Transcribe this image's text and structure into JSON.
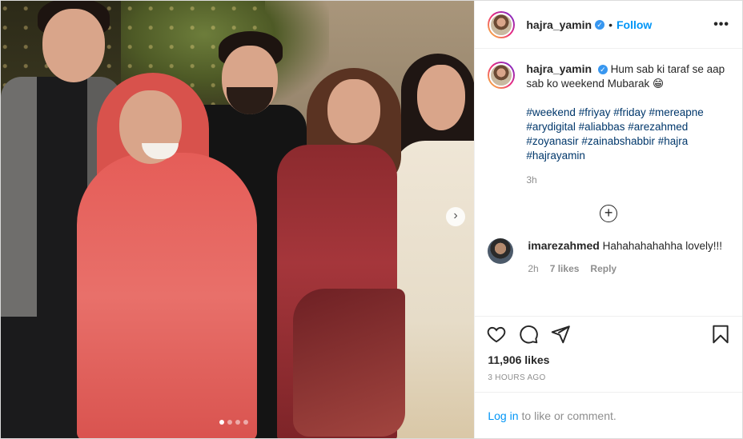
{
  "post": {
    "username": "hajra_yamin",
    "separator": "•",
    "follow_label": "Follow",
    "more_label": "•••",
    "verified_glyph": "✓",
    "icons": {
      "verified": "verified-badge-icon",
      "more": "more-options-icon",
      "next": "chevron-right-icon",
      "load_more": "plus-circle-icon",
      "like": "heart-icon",
      "comment": "comment-bubble-icon",
      "share": "paper-plane-icon",
      "save": "bookmark-icon"
    }
  },
  "caption": {
    "username": "hajra_yamin",
    "text": "Hum sab ki taraf se aap sab ko weekend Mubarak 😁",
    "hashtags": [
      "#weekend",
      "#friyay",
      "#friday",
      "#mereapne",
      "#arydigital",
      "#aliabbas",
      "#arezahmed",
      "#zoyanasir",
      "#zainabshabbir",
      "#hajra",
      "#hajrayamin"
    ],
    "time": "3h"
  },
  "load_more_glyph": "+",
  "next_glyph": "›",
  "comments": [
    {
      "username": "imarezahmed",
      "text": "Hahahahahahha lovely!!!",
      "time": "2h",
      "likes": "7 likes",
      "reply_label": "Reply"
    }
  ],
  "likes_count": "11,906 likes",
  "posted_ago": "3 HOURS AGO",
  "login": {
    "link_text": "Log in",
    "rest_text": "to like or comment."
  },
  "carousel": {
    "current_slide": 1,
    "total_slides": 4
  },
  "colors": {
    "accent": "#0095f6",
    "hashtag": "#00376b",
    "muted": "#8e8e8e",
    "text": "#262626"
  }
}
